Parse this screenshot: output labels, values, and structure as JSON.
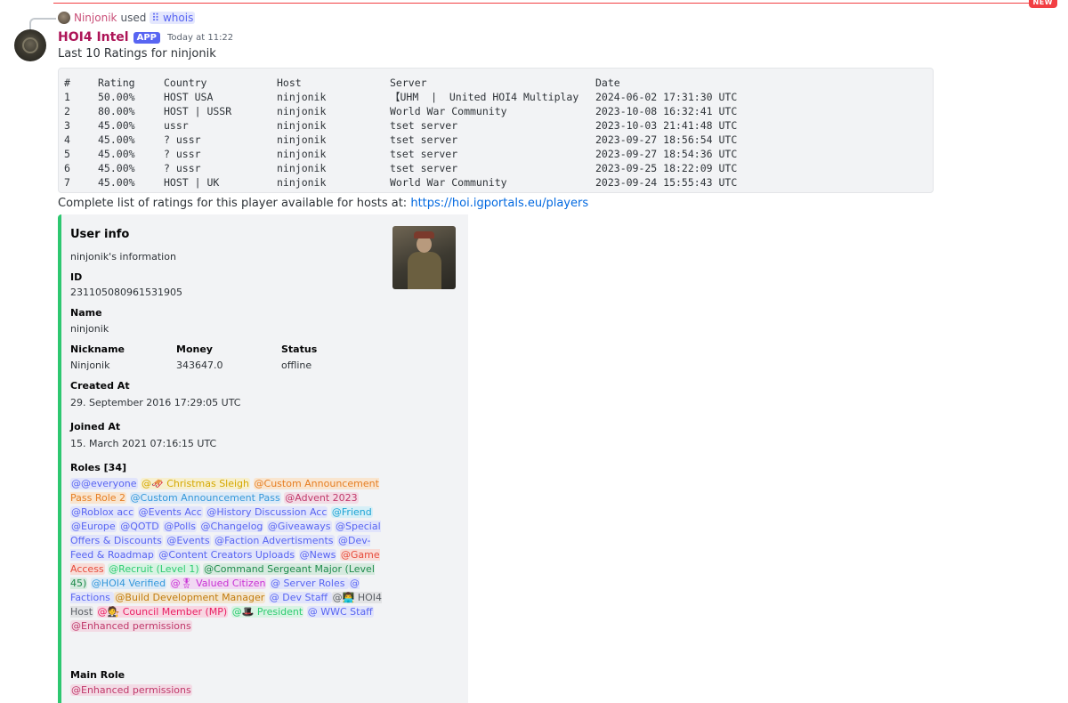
{
  "banner": {
    "new_label": "NEW"
  },
  "reply": {
    "user": "Ninjonik",
    "verb": "used",
    "command": "whois"
  },
  "message": {
    "bot_name": "HOI4 Intel",
    "app_tag": "APP",
    "timestamp": "Today at 11:22",
    "heading": "Last 10 Ratings for ninjonik",
    "footer_text": "Complete list of ratings for this player available for hosts at:",
    "footer_link": "https://hoi.igportals.eu/players"
  },
  "ratings_table": {
    "headers": [
      "#",
      "Rating",
      "Country",
      "Host",
      "Server",
      "Date"
    ],
    "rows": [
      [
        "1",
        "50.00%",
        "HOST USA",
        "ninjonik",
        "【UHM  |  United HOI4 Multiplay",
        "2024-06-02 17:31:30 UTC"
      ],
      [
        "2",
        "80.00%",
        "HOST | USSR",
        "ninjonik",
        "World War Community",
        "2023-10-08 16:32:41 UTC"
      ],
      [
        "3",
        "45.00%",
        "ussr",
        "ninjonik",
        "tset server",
        "2023-10-03 21:41:48 UTC"
      ],
      [
        "4",
        "45.00%",
        "? ussr",
        "ninjonik",
        "tset server",
        "2023-09-27 18:56:54 UTC"
      ],
      [
        "5",
        "45.00%",
        "? ussr",
        "ninjonik",
        "tset server",
        "2023-09-27 18:54:36 UTC"
      ],
      [
        "6",
        "45.00%",
        "? ussr",
        "ninjonik",
        "tset server",
        "2023-09-25 18:22:09 UTC"
      ],
      [
        "7",
        "45.00%",
        "HOST | UK",
        "ninjonik",
        "World War Community",
        "2023-09-24 15:55:43 UTC"
      ]
    ]
  },
  "embed": {
    "title": "User info",
    "description": "ninjonik's information",
    "accent_color": "#2dc770",
    "fields": {
      "id": {
        "name": "ID",
        "value": "231105080961531905"
      },
      "name": {
        "name": "Name",
        "value": "ninjonik"
      },
      "nickname": {
        "name": "Nickname",
        "value": "Ninjonik"
      },
      "money": {
        "name": "Money",
        "value": "343647.0"
      },
      "status": {
        "name": "Status",
        "value": "offline"
      },
      "created": {
        "name": "Created At",
        "value": "29. September 2016 17:29:05 UTC"
      },
      "joined": {
        "name": "Joined At",
        "value": "15. March 2021 07:16:15 UTC"
      },
      "roles_title": "Roles [34]",
      "main_role_title": "Main Role",
      "main_role": "@Enhanced permissions"
    },
    "roles": [
      {
        "label": "@@everyone",
        "color": "blue"
      },
      {
        "label": "@🛷 Christmas Sleigh",
        "color": "yellow"
      },
      {
        "label": "@Custom Announcement Pass Role 2",
        "color": "orange"
      },
      {
        "label": "@Custom Announcement Pass",
        "color": "lblue"
      },
      {
        "label": "@Advent 2023",
        "color": "pink"
      },
      {
        "label": "@Roblox acc",
        "color": "blue"
      },
      {
        "label": "@Events Acc",
        "color": "blue"
      },
      {
        "label": "@History Discussion Acc",
        "color": "blue"
      },
      {
        "label": "@Friend",
        "color": "cyan"
      },
      {
        "label": "@Europe",
        "color": "blue"
      },
      {
        "label": "@QOTD",
        "color": "blue"
      },
      {
        "label": "@Polls",
        "color": "blue"
      },
      {
        "label": "@Changelog",
        "color": "blue"
      },
      {
        "label": "@Giveaways",
        "color": "blue"
      },
      {
        "label": "@Special Offers & Discounts",
        "color": "blue"
      },
      {
        "label": "@Events",
        "color": "blue"
      },
      {
        "label": "@Faction Advertisments",
        "color": "blue"
      },
      {
        "label": "@Dev-Feed & Roadmap",
        "color": "blue"
      },
      {
        "label": "@Content Creators Uploads",
        "color": "blue"
      },
      {
        "label": "@News",
        "color": "blue"
      },
      {
        "label": "@Game Access",
        "color": "red"
      },
      {
        "label": "@Recruit (Level 1)",
        "color": "green"
      },
      {
        "label": "@Command Sergeant Major (Level 45)",
        "color": "dgreen"
      },
      {
        "label": "@HOI4 Verified",
        "color": "lblue"
      },
      {
        "label": "@🎖 Valued Citizen",
        "color": "magenta"
      },
      {
        "label": "@                    Server Roles                    ",
        "color": "blue"
      },
      {
        "label": "@                    Factions                    ",
        "color": "blue"
      },
      {
        "label": "@Build Development Manager",
        "color": "gold"
      },
      {
        "label": "@                    Dev Staff                    ",
        "color": "blue"
      },
      {
        "label": "@👨‍💻 HOI4 Host",
        "color": "grey"
      },
      {
        "label": "@🧑‍⚖️ Council Member (MP)",
        "color": "rose"
      },
      {
        "label": "@🎩 President",
        "color": "green"
      },
      {
        "label": "@                    WWC Staff                    ",
        "color": "blue"
      },
      {
        "label": "@Enhanced permissions",
        "color": "pink"
      }
    ]
  }
}
